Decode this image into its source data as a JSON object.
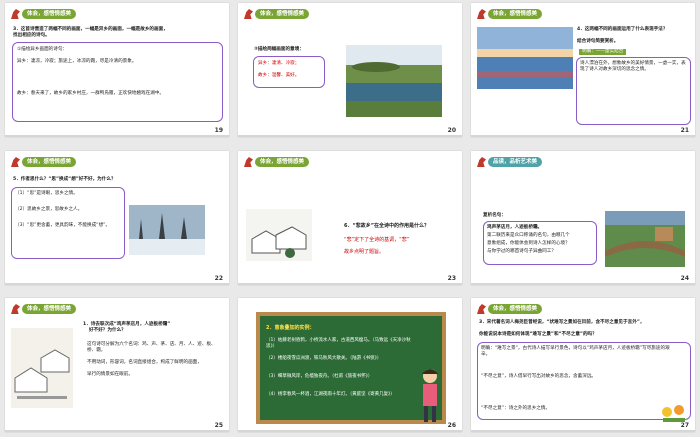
{
  "header_label": "体会，感悟情感美",
  "header_label_art": "品读，品析艺术美",
  "slides": [
    {
      "number": "19",
      "lines": [
        "3．这首诗营造了两幅不同的画面，一幅是异乡的画面，一幅是故乡的画面，",
        "找出相应的诗句。",
        "①描绘异乡画面的诗句：",
        "异乡：凄凉，冷寂；旅途上，冰凉的霜，尽是冷清的景象。",
        "故乡：春天来了，故乡的家乡村庄，一群鸭凫雁，正欢快地嬉戏在湖中。"
      ]
    },
    {
      "number": "20",
      "lines": [
        "②描绘两幅画面的意境：",
        "异乡：凄清、冷寂；",
        "故乡：温馨、美好。"
      ]
    },
    {
      "number": "21",
      "lines": [
        "4．这两幅不同的画面运用了什么表现手法？",
        "结合诗句简要赏析。",
        "明确：——虚实结合",
        "诗人漂泊在外，想象故乡的美好情景，一虚一实，表现了诗人对故乡深切的思念之情。"
      ]
    },
    {
      "number": "22",
      "lines": [
        "5．作者思什么？“思”换成“想”好不好，为什么？",
        "（1）“思”是诗眼，思乡之情。",
        "（2）思故乡之景，思故乡之人。",
        "（3）“思”更含蓄，更具韵味，不能换成“想”。"
      ]
    },
    {
      "number": "23",
      "lines": [
        "6．“悲故乡”在全诗中的作用是什么？",
        "“悲”定下了全诗的基调，“悲”",
        "故乡点明了题旨。"
      ]
    },
    {
      "number": "24",
      "lines": [
        "复析名句：",
        "鸡声茅店月，人迹板桥霜。",
        "第二联历来是众口称诵的名句，由哪几个",
        "意象组成，你能体会到诗人怎样的心境？",
        "与你学过的哪首诗句子异曲同工？"
      ]
    },
    {
      "number": "25",
      "lines": [
        "1．诗去联次成“鸡声茅店月，人迹板桥霜”",
        "好不好？为什么？",
        "这句诗可分解为六个名词：鸡、声、茅、店、月、人、迹、板、桥、霜，",
        "不用动词，形容词，名词直接组合，构成了鲜明的画面，",
        "早行的情景如在眼前。"
      ]
    },
    {
      "number": "26",
      "lines": [
        "2．意象叠加的实例：",
        "（1）枯藤老树昏鸦，小桥流水人家，古道西风瘦马。（马致远《天净沙秋思》）",
        "（2）楼船夜雪瓜洲渡，铁马秋风大散关。（陆游《书愤》）",
        "（3）细草微风岸，危樯独夜舟。（杜甫《旅夜书怀》）",
        "（4）杨李春风一杯酒，江湖夜雨十年灯。（黄庭坚《寄黄几复》）"
      ]
    },
    {
      "number": "27",
      "lines": [
        "3．宋代著名词人梅尧臣曾经说，“状难写之景如在目前，含不尽之意见于言外”，",
        "你能说说本诗是如何体现“难写之景”和“不尽之意”的吗？",
        "明确：“难写之景”，古代诗人描写早行景色，诗句以“鸡声茅店月，人迹板桥霜”写尽旅途的艰辛。",
        "“不尽之意”，诗人借早行写出对故乡的思念，含蓄深远。",
        "“不尽之意”：诗之外的思乡之情。"
      ]
    }
  ]
}
